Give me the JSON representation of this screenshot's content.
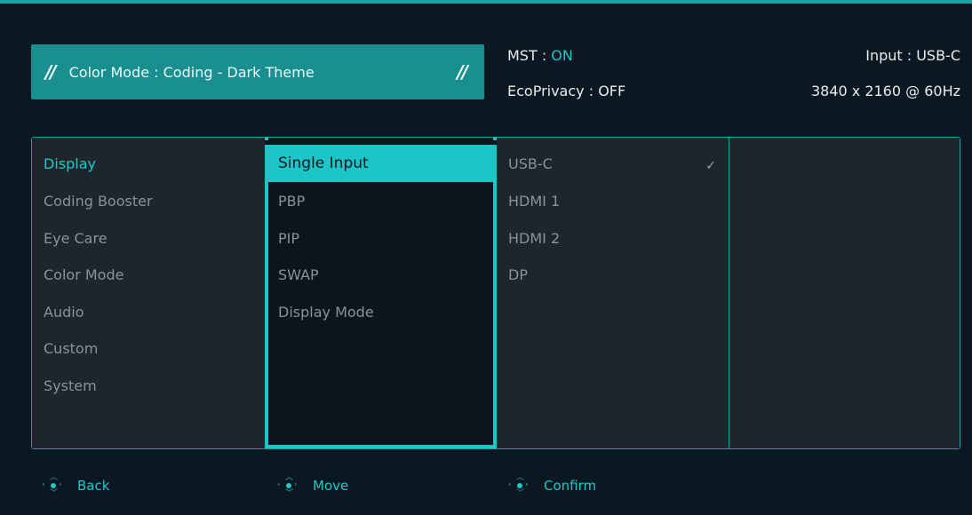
{
  "header": {
    "color_mode_label": "Color Mode : Coding - Dark Theme",
    "mst_label": "MST : ",
    "mst_value": "ON",
    "ecoprivacy_label": "EcoPrivacy : OFF",
    "input_label": "Input : USB-C",
    "resolution_label": "3840 x 2160 @ 60Hz"
  },
  "menu": {
    "categories": [
      "Display",
      "Coding Booster",
      "Eye Care",
      "Color Mode",
      "Audio",
      "Custom",
      "System"
    ],
    "display_options": [
      "Single Input",
      "PBP",
      "PIP",
      "SWAP",
      "Display Mode"
    ],
    "input_sources": [
      "USB-C",
      "HDMI 1",
      "HDMI 2",
      "DP"
    ],
    "selected_source_check": "✓"
  },
  "footer": {
    "back_label": "Back",
    "move_label": "Move",
    "confirm_label": "Confirm"
  },
  "colors": {
    "accent": "#1cc6c6",
    "banner": "#1a8f8f",
    "background": "#0b1822"
  }
}
